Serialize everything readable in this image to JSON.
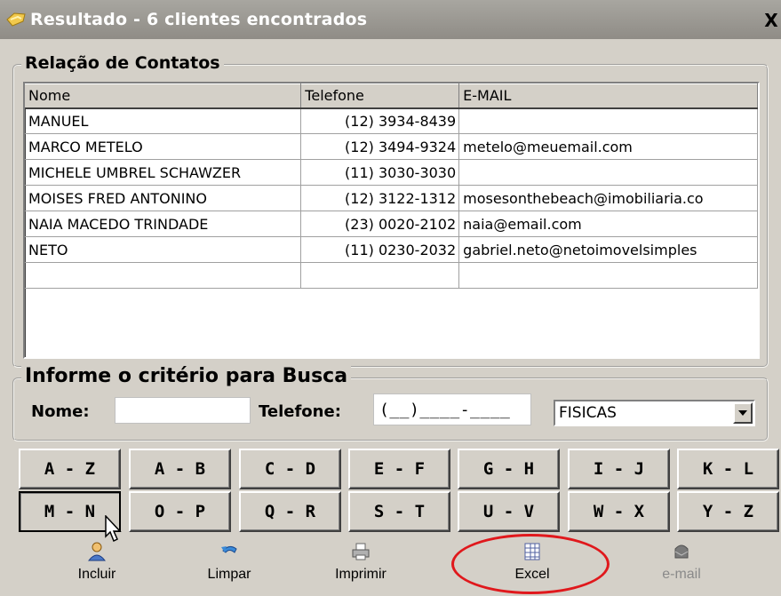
{
  "window": {
    "title": "Resultado - 6 clientes encontrados",
    "close_label": "X"
  },
  "contacts": {
    "legend": "Relação de Contatos",
    "columns": [
      "Nome",
      "Telefone",
      "E-MAIL"
    ],
    "rows": [
      {
        "nome": "MANUEL",
        "telefone": "(12) 3934-8439",
        "email": ""
      },
      {
        "nome": "MARCO METELO",
        "telefone": "(12) 3494-9324",
        "email": "metelo@meuemail.com"
      },
      {
        "nome": "MICHELE UMBREL SCHAWZER",
        "telefone": "(11) 3030-3030",
        "email": ""
      },
      {
        "nome": "MOISES FRED ANTONINO",
        "telefone": "(12) 3122-1312",
        "email": "mosesonthebeach@imobiliaria.co"
      },
      {
        "nome": "NAIA MACEDO TRINDADE",
        "telefone": "(23) 0020-2102",
        "email": "naia@email.com"
      },
      {
        "nome": "NETO",
        "telefone": "(11) 0230-2032",
        "email": "gabriel.neto@netoimovelsimples"
      }
    ]
  },
  "search": {
    "legend": "Informe o critério para Busca",
    "nome_label": "Nome:",
    "nome_value": "",
    "telefone_label": "Telefone:",
    "telefone_mask": "(__)____-____",
    "tipo_selected": "FISICAS"
  },
  "letters": {
    "row1": [
      "A - Z",
      "A - B",
      "C - D",
      "E - F",
      "G - H",
      "I - J",
      "K - L"
    ],
    "row2": [
      "M - N",
      "O - P",
      "Q - R",
      "S - T",
      "U - V",
      "W - X",
      "Y - Z"
    ],
    "pressed": "M - N"
  },
  "toolbar": {
    "incluir": "Incluir",
    "limpar": "Limpar",
    "imprimir": "Imprimir",
    "excel": "Excel",
    "email": "e-mail"
  },
  "colors": {
    "highlight_circle": "#e0181c",
    "title_bar": "#9a9892"
  }
}
